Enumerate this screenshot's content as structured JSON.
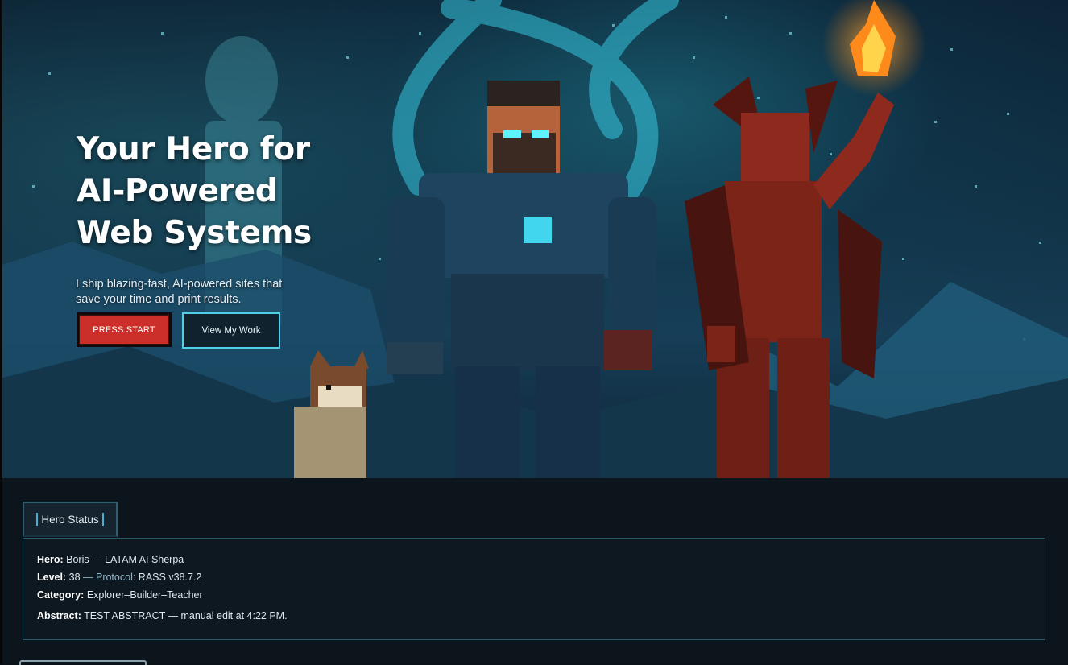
{
  "hero": {
    "title_lines": [
      "Your Hero for",
      "AI-Powered",
      "Web Systems"
    ],
    "subtitle_lines": [
      "I ship blazing-fast, AI-powered sites that",
      "save your time and print results."
    ],
    "primary_button": "PRESS START",
    "secondary_button": "View My Work"
  },
  "status": {
    "tab_label": "Hero Status",
    "hero_label": "Hero:",
    "hero_value": " Boris — LATAM AI Sherpa",
    "level_label": "Level:",
    "level_value": " 38",
    "level_sep": " — ",
    "protocol_label": "Protocol:",
    "protocol_value": " RASS v38.7.2",
    "category_label": "Category:",
    "category_value": " Explorer–Builder–Teacher",
    "abstract_label": "Abstract:",
    "abstract_value": " TEST ABSTRACT — manual edit at 4:22 PM."
  },
  "colors": {
    "accent_red": "#cc2f2a",
    "accent_cyan": "#4fd0e8",
    "panel_border": "#2a5866",
    "background": "#0b1218"
  },
  "icons": [
    "flame-icon"
  ]
}
